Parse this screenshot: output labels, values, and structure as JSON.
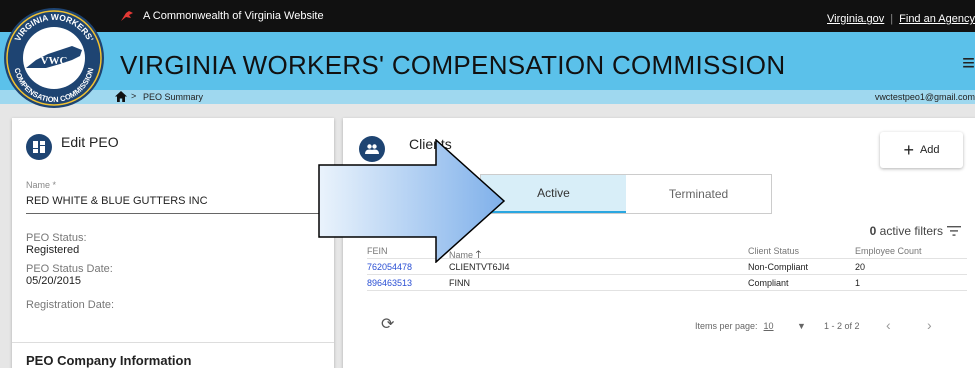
{
  "topbar": {
    "commonwealth_text": "A Commonwealth of Virginia Website",
    "link_virginia_gov": "Virginia.gov",
    "link_find_agency": "Find an Agency"
  },
  "header": {
    "title": "VIRGINIA WORKERS' COMPENSATION COMMISSION",
    "menu_icon": "hamburger-icon",
    "accent_color": "#5bc1ea"
  },
  "seal": {
    "top_text": "VIRGINIA WORKERS'",
    "center_text": "VWC",
    "bottom_text": "COMPENSATION COMMISSION"
  },
  "breadcrumb": {
    "home_icon": "home-icon",
    "separator": ">",
    "current": "PEO Summary",
    "user_email": "vwctestpeo1@gmail.com"
  },
  "edit_peo": {
    "title": "Edit PEO",
    "name_label": "Name",
    "required_mark": "*",
    "name_value": "RED WHITE & BLUE GUTTERS INC",
    "status_label": "PEO Status:",
    "status_value": "Registered",
    "status_date_label": "PEO Status Date:",
    "status_date_value": "05/20/2015",
    "registration_date_label": "Registration Date:",
    "company_section_title": "PEO Company Information"
  },
  "clients": {
    "title": "Clients",
    "add_button_label": "Add",
    "tabs": [
      {
        "label": "Active",
        "active": true
      },
      {
        "label": "Terminated",
        "active": false
      }
    ],
    "filters_count": "0",
    "filters_text": "active filters",
    "columns": {
      "fein": "FEIN",
      "name": "Name",
      "client_status": "Client Status",
      "employee_count": "Employee Count"
    },
    "rows": [
      {
        "fein": "762054478",
        "name": "CLIENTVT6JI4",
        "client_status": "Non-Compliant",
        "employee_count": "20"
      },
      {
        "fein": "896463513",
        "name": "FINN",
        "client_status": "Compliant",
        "employee_count": "1"
      }
    ],
    "paginator": {
      "items_per_page_label": "Items per page:",
      "items_per_page_value": "10",
      "range": "1 - 2 of 2"
    }
  }
}
